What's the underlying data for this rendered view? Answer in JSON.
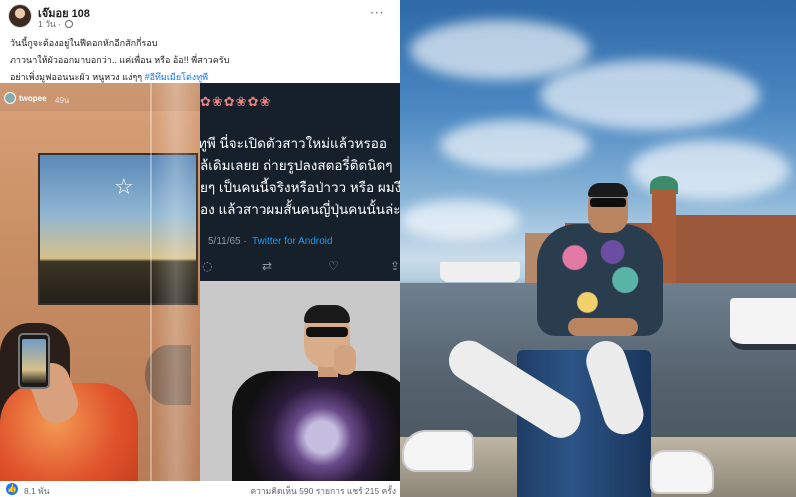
{
  "post": {
    "author": "เจ๊มอย 108",
    "timestamp": "1 วัน",
    "more_label": "···",
    "lines": [
      "วันนี้กูจะต้องอยู่ในฟีดอกหักอีกสักกี่รอบ",
      "ภาวนาให้ผัวออกมาบอกว่า.. แค่เพื่อน หรือ อ้อ!! พี่สาวครับ",
      "อย่าเพิ่งมูฟออนนะผัว หนูหวง แง่ๆๆ"
    ],
    "hashtag": "#อีทึมเมียโต่งทูพี",
    "story": {
      "username": "twopee",
      "time": "49น"
    },
    "tweet": {
      "flowers": "✿❀✿❀✿❀",
      "lines": [
        "ทูพี นี่จะเปิดตัวสาวใหม่แล้วหรออ",
        "ล้เดิมเลยย ถ่ายรูปลงสตอรี่ติดนิดๆ",
        "ยๆ เป็นคนนี้จริงหรือป่าวว หรือ ผมงี",
        "อง แล้วสาวผมสั้นคนญี่ปุ่นคนนั้นล่ะ"
      ],
      "date": "5/11/65 ·",
      "source": "Twitter for Android"
    },
    "reactions": "8.1 พัน",
    "engagement": "ความคิดเห็น 590 รายการ  แชร์ 215 ครั้ง"
  },
  "icons": {
    "reply": "reply-icon",
    "retweet": "retweet-icon",
    "like": "heart-icon",
    "share": "share-icon",
    "reaction": "like-reaction-icon"
  },
  "colors": {
    "link": "#1877f2",
    "twitter_bg": "#15202b",
    "twitter_link": "#1d9bf0"
  }
}
